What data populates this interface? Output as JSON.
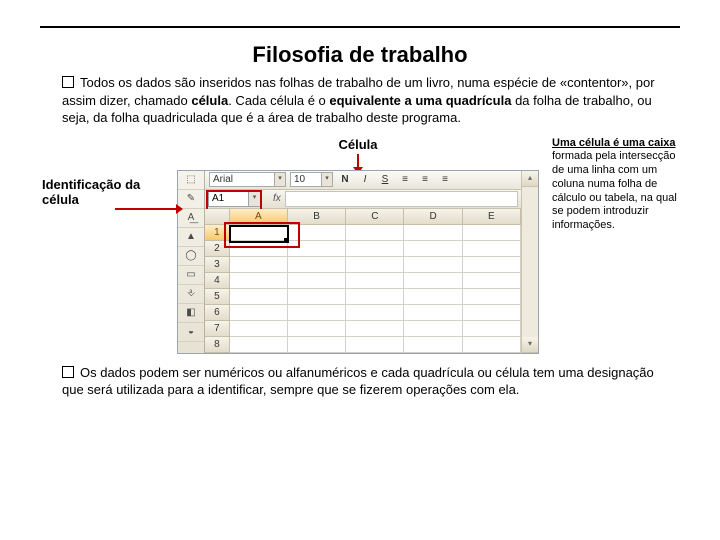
{
  "title": "Filosofia de trabalho",
  "para1_prefix": "Todos os dados são inseridos nas folhas de trabalho de um livro, numa espécie de «contentor», por assim dizer, chamado ",
  "para1_b1": "célula",
  "para1_mid1": ". Cada célula é o ",
  "para1_b2": "equivalente a uma quadrícula",
  "para1_mid2": " da folha de trabalho, ou seja, da folha quadriculada que é a área de trabalho deste programa.",
  "left_label": "Identificação da célula",
  "cell_label": "Célula",
  "side_b1": "Uma célula é uma caixa",
  "side_rest": " formada pela intersecção de uma linha com um coluna numa folha de cálculo ou tabela, na qual se podem introduzir informações.",
  "para2": "Os dados podem ser numéricos ou alfanuméricos e cada quadrícula ou célula tem uma designação que será utilizada para a identificar, sempre que se fizerem operações com ela.",
  "sheet": {
    "font_name": "Arial",
    "font_size": "10",
    "name_box": "A1",
    "fx_label": "fx",
    "columns": [
      "A",
      "B",
      "C",
      "D",
      "E"
    ],
    "rows": [
      "1",
      "2",
      "3",
      "4",
      "5",
      "6",
      "7",
      "8"
    ],
    "selected_col": "A",
    "selected_row": "1",
    "toolbar_btns": [
      "N",
      "I",
      "S",
      "≡",
      "≡",
      "≡"
    ],
    "vtool": [
      "⬚",
      "✎",
      "A͟",
      "▲",
      "◯",
      "▭",
      "⎀",
      "◧",
      "◒"
    ]
  }
}
